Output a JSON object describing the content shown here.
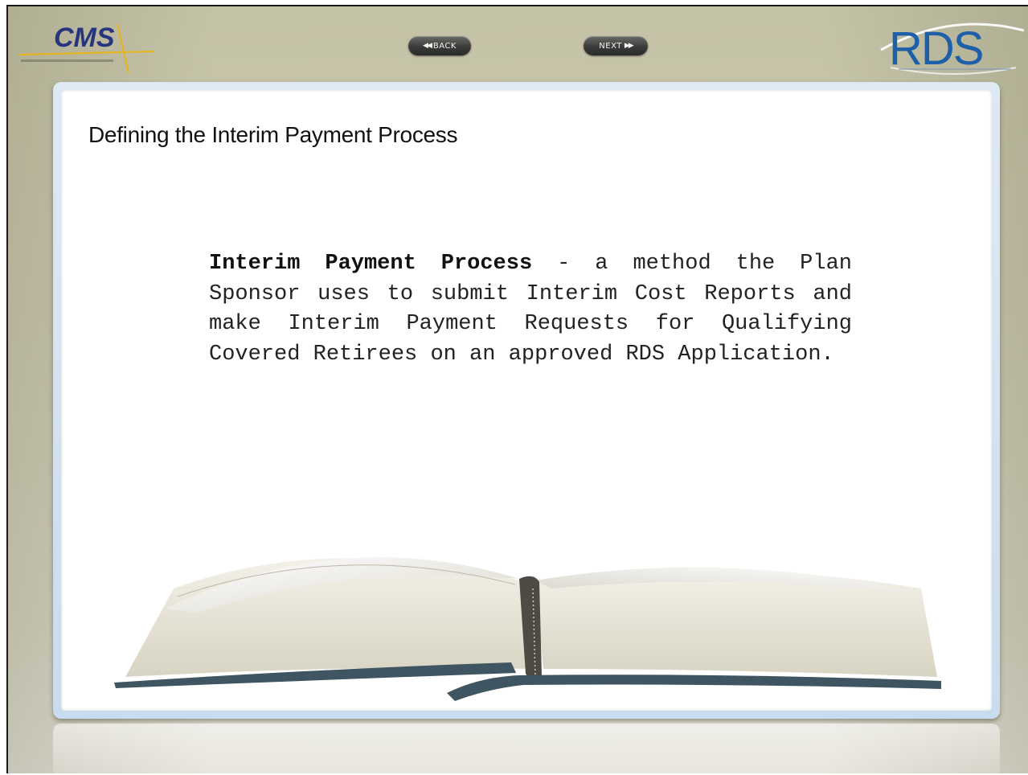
{
  "header": {
    "cms_logo_text": "CMS",
    "back_label": "BACK",
    "next_label": "NEXT",
    "rds_logo_text": "RDS"
  },
  "icons": {
    "back": "rewind-icon",
    "next": "fast-forward-icon"
  },
  "slide": {
    "title": "Defining the Interim Payment Process",
    "term": "Interim Payment Process",
    "definition": " - a method the Plan Sponsor uses to submit Interim Cost Reports and make Interim Payment Requests for Qualifying Covered Retirees on an approved RDS Application."
  },
  "colors": {
    "cms_blue": "#26357e",
    "cms_gold": "#e7b519",
    "rds_blue": "#1d5fa8",
    "panel_border": "#c9dbee"
  }
}
